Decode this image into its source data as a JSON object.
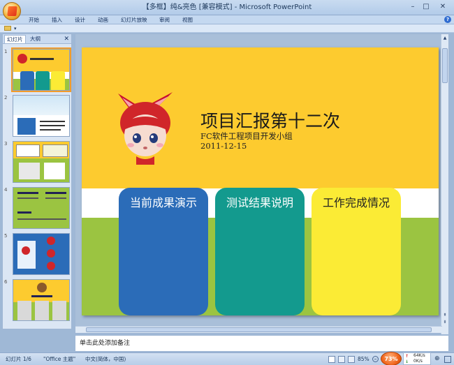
{
  "window": {
    "title": "【多框】纯&亮色 [兼容模式] - Microsoft PowerPoint",
    "controls": [
      "–",
      "□",
      "✕"
    ]
  },
  "ribbon": {
    "tabs": [
      "开始",
      "插入",
      "设计",
      "动画",
      "幻灯片放映",
      "审阅",
      "视图"
    ]
  },
  "panel": {
    "tabs": [
      "幻灯片",
      "大纲"
    ],
    "close": "✕",
    "slide_numbers": [
      "1",
      "2",
      "3",
      "4",
      "5",
      "6"
    ]
  },
  "slide": {
    "title": "项目汇报第十二次",
    "subtitle": "FC软件工程项目开发小组",
    "date": "2011-12-15",
    "cards": [
      {
        "label": "当前成果演示",
        "color": "#2b6cb8",
        "text_color": "#ffffff"
      },
      {
        "label": "测试结果说明",
        "color": "#139a8e",
        "text_color": "#ffffff"
      },
      {
        "label": "工作完成情况",
        "color": "#fbeb35",
        "text_color": "#222222"
      }
    ]
  },
  "notes": {
    "placeholder": "单击此处添加备注"
  },
  "status": {
    "slide_info": "幻灯片 1/6",
    "theme": "\"Office 主题\"",
    "language": "中文(简体，中国)",
    "zoom": "85%",
    "zoom_bubble": "73%",
    "net_up": "64K/s",
    "net_down": "0K/s"
  },
  "colors": {
    "slide_yellow": "#fdcb2f",
    "slide_green": "#9bc441",
    "selection": "#f39c2a"
  }
}
